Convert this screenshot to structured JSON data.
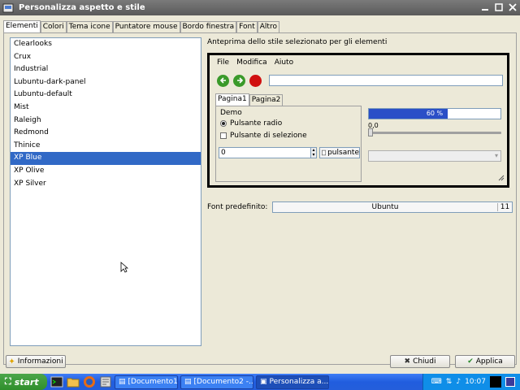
{
  "window": {
    "title": "Personalizza aspetto e stile"
  },
  "tabs": [
    {
      "label": "Elementi",
      "active": true
    },
    {
      "label": "Colori"
    },
    {
      "label": "Tema icone"
    },
    {
      "label": "Puntatore mouse"
    },
    {
      "label": "Bordo finestra"
    },
    {
      "label": "Font"
    },
    {
      "label": "Altro"
    }
  ],
  "themes": {
    "items": [
      "Clearlooks",
      "Crux",
      "Industrial",
      "Lubuntu-dark-panel",
      "Lubuntu-default",
      "Mist",
      "Raleigh",
      "Redmond",
      "Thinice",
      "XP Blue",
      "XP Olive",
      "XP Silver"
    ],
    "selected": "XP Blue"
  },
  "preview": {
    "label": "Anteprima dello stile selezionato per gli elementi",
    "menu": [
      "File",
      "Modifica",
      "Aiuto"
    ],
    "tabs": [
      "Pagina1",
      "Pagina2"
    ],
    "frame_label": "Demo",
    "radio_label": "Pulsante radio",
    "check_label": "Pulsante di selezione",
    "spin_value": "0",
    "button_label": "pulsante",
    "progress_text": "60 %",
    "progress_value": 0.6,
    "scale_value": "0,0"
  },
  "font": {
    "label": "Font predefinito:",
    "name": "Ubuntu",
    "size": "11"
  },
  "buttons": {
    "info": "Informazioni",
    "close": "Chiudi",
    "apply": "Applica"
  },
  "taskbar": {
    "start": "start",
    "tasks": [
      "[Documento1 -...",
      "[Documento2 -...",
      "Personalizza a..."
    ],
    "time": "10:07"
  },
  "colors": {
    "selection": "#3169c6",
    "taskbar": "#245edb",
    "progress": "#2a4fc7"
  }
}
